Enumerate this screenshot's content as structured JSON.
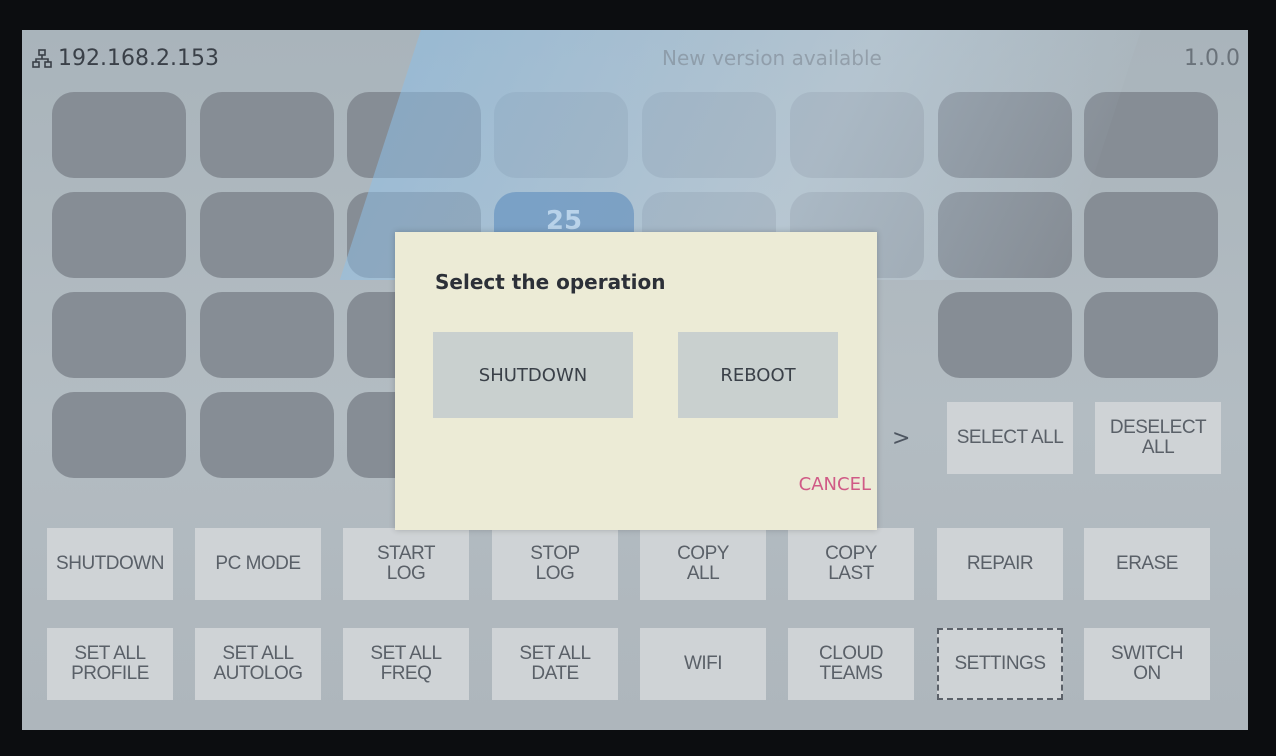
{
  "status_bar": {
    "ip_address": "192.168.2.153",
    "update_message": "New version available",
    "version": "1.0.0",
    "network_icon": "network-icon"
  },
  "device_tile_badge": "25",
  "dialog": {
    "title": "Select the operation",
    "shutdown_label": "SHUTDOWN",
    "reboot_label": "REBOOT",
    "cancel_label": "CANCEL"
  },
  "selection": {
    "next_arrow": ">",
    "select_all": "SELECT ALL",
    "deselect_all": "DESELECT ALL"
  },
  "actions_row1": {
    "shutdown": "SHUTDOWN",
    "pc_mode": "PC MODE",
    "start_log": "START\nLOG",
    "stop_log": "STOP\nLOG",
    "copy_all": "COPY\nALL",
    "copy_last": "COPY\nLAST",
    "repair": "REPAIR",
    "erase": "ERASE"
  },
  "actions_row2": {
    "set_all_profile": "SET ALL\nPROFILE",
    "set_all_autolog": "SET ALL\nAUTOLOG",
    "set_all_freq": "SET ALL\nFREQ",
    "set_all_date": "SET ALL\nDATE",
    "wifi": "WIFI",
    "cloud_teams": "CLOUD\nTEAMS",
    "settings": "SETTINGS",
    "switch_on": "SWITCH\nON"
  },
  "colors": {
    "dialog_bg": "#ecebd6",
    "cancel": "#d05a86",
    "button_bg": "#cfd3d6"
  }
}
